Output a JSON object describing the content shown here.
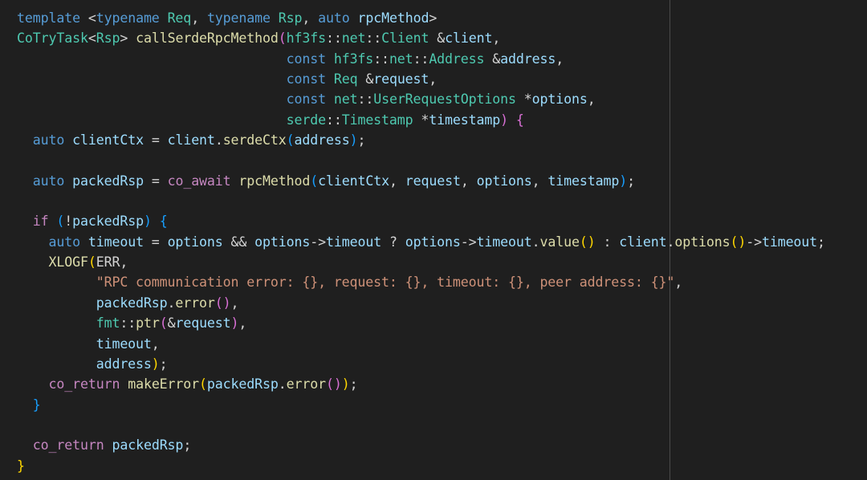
{
  "editor": {
    "background": "#1f1f1f",
    "colors": {
      "keyword": "#569cd6",
      "control": "#c586c0",
      "type": "#4ec9b0",
      "function": "#dcdcaa",
      "variable": "#9cdcfe",
      "plain": "#d4d4d4",
      "string": "#ce9178",
      "bracket_gold": "#ffd700",
      "bracket_orchid": "#da70d6",
      "bracket_blue": "#179fff"
    },
    "lines": [
      [
        [
          "kw",
          "template"
        ],
        [
          "plain",
          " <"
        ],
        [
          "kw",
          "typename"
        ],
        [
          "plain",
          " "
        ],
        [
          "type",
          "Req"
        ],
        [
          "plain",
          ", "
        ],
        [
          "kw",
          "typename"
        ],
        [
          "plain",
          " "
        ],
        [
          "type",
          "Rsp"
        ],
        [
          "plain",
          ", "
        ],
        [
          "kw",
          "auto"
        ],
        [
          "plain",
          " "
        ],
        [
          "var",
          "rpcMethod"
        ],
        [
          "plain",
          ">"
        ]
      ],
      [
        [
          "type",
          "CoTryTask"
        ],
        [
          "plain",
          "<"
        ],
        [
          "type",
          "Rsp"
        ],
        [
          "plain",
          "> "
        ],
        [
          "fn",
          "callSerdeRpcMethod"
        ],
        [
          "b2",
          "("
        ],
        [
          "type",
          "hf3fs"
        ],
        [
          "plain",
          "::"
        ],
        [
          "type",
          "net"
        ],
        [
          "plain",
          "::"
        ],
        [
          "type",
          "Client"
        ],
        [
          "plain",
          " &"
        ],
        [
          "var",
          "client"
        ],
        [
          "plain",
          ","
        ]
      ],
      [
        [
          "plain",
          "                                  "
        ],
        [
          "kw",
          "const"
        ],
        [
          "plain",
          " "
        ],
        [
          "type",
          "hf3fs"
        ],
        [
          "plain",
          "::"
        ],
        [
          "type",
          "net"
        ],
        [
          "plain",
          "::"
        ],
        [
          "type",
          "Address"
        ],
        [
          "plain",
          " &"
        ],
        [
          "var",
          "address"
        ],
        [
          "plain",
          ","
        ]
      ],
      [
        [
          "plain",
          "                                  "
        ],
        [
          "kw",
          "const"
        ],
        [
          "plain",
          " "
        ],
        [
          "type",
          "Req"
        ],
        [
          "plain",
          " &"
        ],
        [
          "var",
          "request"
        ],
        [
          "plain",
          ","
        ]
      ],
      [
        [
          "plain",
          "                                  "
        ],
        [
          "kw",
          "const"
        ],
        [
          "plain",
          " "
        ],
        [
          "type",
          "net"
        ],
        [
          "plain",
          "::"
        ],
        [
          "type",
          "UserRequestOptions"
        ],
        [
          "plain",
          " *"
        ],
        [
          "var",
          "options"
        ],
        [
          "plain",
          ","
        ]
      ],
      [
        [
          "plain",
          "                                  "
        ],
        [
          "type",
          "serde"
        ],
        [
          "plain",
          "::"
        ],
        [
          "type",
          "Timestamp"
        ],
        [
          "plain",
          " *"
        ],
        [
          "var",
          "timestamp"
        ],
        [
          "b2",
          ")"
        ],
        [
          "plain",
          " "
        ],
        [
          "b2",
          "{"
        ]
      ],
      [
        [
          "plain",
          "  "
        ],
        [
          "kw",
          "auto"
        ],
        [
          "plain",
          " "
        ],
        [
          "var",
          "clientCtx"
        ],
        [
          "plain",
          " = "
        ],
        [
          "var",
          "client"
        ],
        [
          "plain",
          "."
        ],
        [
          "fn",
          "serdeCtx"
        ],
        [
          "b3",
          "("
        ],
        [
          "var",
          "address"
        ],
        [
          "b3",
          ")"
        ],
        [
          "plain",
          ";"
        ]
      ],
      [
        [
          "plain",
          ""
        ]
      ],
      [
        [
          "plain",
          "  "
        ],
        [
          "kw",
          "auto"
        ],
        [
          "plain",
          " "
        ],
        [
          "var",
          "packedRsp"
        ],
        [
          "plain",
          " = "
        ],
        [
          "ctl",
          "co_await"
        ],
        [
          "plain",
          " "
        ],
        [
          "fn",
          "rpcMethod"
        ],
        [
          "b3",
          "("
        ],
        [
          "var",
          "clientCtx"
        ],
        [
          "plain",
          ", "
        ],
        [
          "var",
          "request"
        ],
        [
          "plain",
          ", "
        ],
        [
          "var",
          "options"
        ],
        [
          "plain",
          ", "
        ],
        [
          "var",
          "timestamp"
        ],
        [
          "b3",
          ")"
        ],
        [
          "plain",
          ";"
        ]
      ],
      [
        [
          "plain",
          ""
        ]
      ],
      [
        [
          "plain",
          "  "
        ],
        [
          "ctl",
          "if"
        ],
        [
          "plain",
          " "
        ],
        [
          "b3",
          "("
        ],
        [
          "plain",
          "!"
        ],
        [
          "var",
          "packedRsp"
        ],
        [
          "b3",
          ")"
        ],
        [
          "plain",
          " "
        ],
        [
          "b3",
          "{"
        ]
      ],
      [
        [
          "plain",
          "    "
        ],
        [
          "kw",
          "auto"
        ],
        [
          "plain",
          " "
        ],
        [
          "var",
          "timeout"
        ],
        [
          "plain",
          " = "
        ],
        [
          "var",
          "options"
        ],
        [
          "plain",
          " && "
        ],
        [
          "var",
          "options"
        ],
        [
          "plain",
          "->"
        ],
        [
          "var",
          "timeout"
        ],
        [
          "plain",
          " ? "
        ],
        [
          "var",
          "options"
        ],
        [
          "plain",
          "->"
        ],
        [
          "var",
          "timeout"
        ],
        [
          "plain",
          "."
        ],
        [
          "fn",
          "value"
        ],
        [
          "b1",
          "()"
        ],
        [
          "plain",
          " : "
        ],
        [
          "var",
          "client"
        ],
        [
          "plain",
          "."
        ],
        [
          "fn",
          "options"
        ],
        [
          "b1",
          "()"
        ],
        [
          "plain",
          "->"
        ],
        [
          "var",
          "timeout"
        ],
        [
          "plain",
          ";"
        ]
      ],
      [
        [
          "plain",
          "    "
        ],
        [
          "fn",
          "XLOGF"
        ],
        [
          "b1",
          "("
        ],
        [
          "plain",
          "ERR,"
        ]
      ],
      [
        [
          "plain",
          "          "
        ],
        [
          "str",
          "\"RPC communication error: {}, request: {}, timeout: {}, peer address: {}\""
        ],
        [
          "plain",
          ","
        ]
      ],
      [
        [
          "plain",
          "          "
        ],
        [
          "var",
          "packedRsp"
        ],
        [
          "plain",
          "."
        ],
        [
          "fn",
          "error"
        ],
        [
          "b2",
          "()"
        ],
        [
          "plain",
          ","
        ]
      ],
      [
        [
          "plain",
          "          "
        ],
        [
          "type",
          "fmt"
        ],
        [
          "plain",
          "::"
        ],
        [
          "fn",
          "ptr"
        ],
        [
          "b2",
          "("
        ],
        [
          "plain",
          "&"
        ],
        [
          "var",
          "request"
        ],
        [
          "b2",
          ")"
        ],
        [
          "plain",
          ","
        ]
      ],
      [
        [
          "plain",
          "          "
        ],
        [
          "var",
          "timeout"
        ],
        [
          "plain",
          ","
        ]
      ],
      [
        [
          "plain",
          "          "
        ],
        [
          "var",
          "address"
        ],
        [
          "b1",
          ")"
        ],
        [
          "plain",
          ";"
        ]
      ],
      [
        [
          "plain",
          "    "
        ],
        [
          "ctl",
          "co_return"
        ],
        [
          "plain",
          " "
        ],
        [
          "fn",
          "makeError"
        ],
        [
          "b1",
          "("
        ],
        [
          "var",
          "packedRsp"
        ],
        [
          "plain",
          "."
        ],
        [
          "fn",
          "error"
        ],
        [
          "b2",
          "()"
        ],
        [
          "b1",
          ")"
        ],
        [
          "plain",
          ";"
        ]
      ],
      [
        [
          "plain",
          "  "
        ],
        [
          "b3",
          "}"
        ]
      ],
      [
        [
          "plain",
          ""
        ]
      ],
      [
        [
          "plain",
          "  "
        ],
        [
          "ctl",
          "co_return"
        ],
        [
          "plain",
          " "
        ],
        [
          "var",
          "packedRsp"
        ],
        [
          "plain",
          ";"
        ]
      ],
      [
        [
          "b1",
          "}"
        ]
      ]
    ]
  }
}
